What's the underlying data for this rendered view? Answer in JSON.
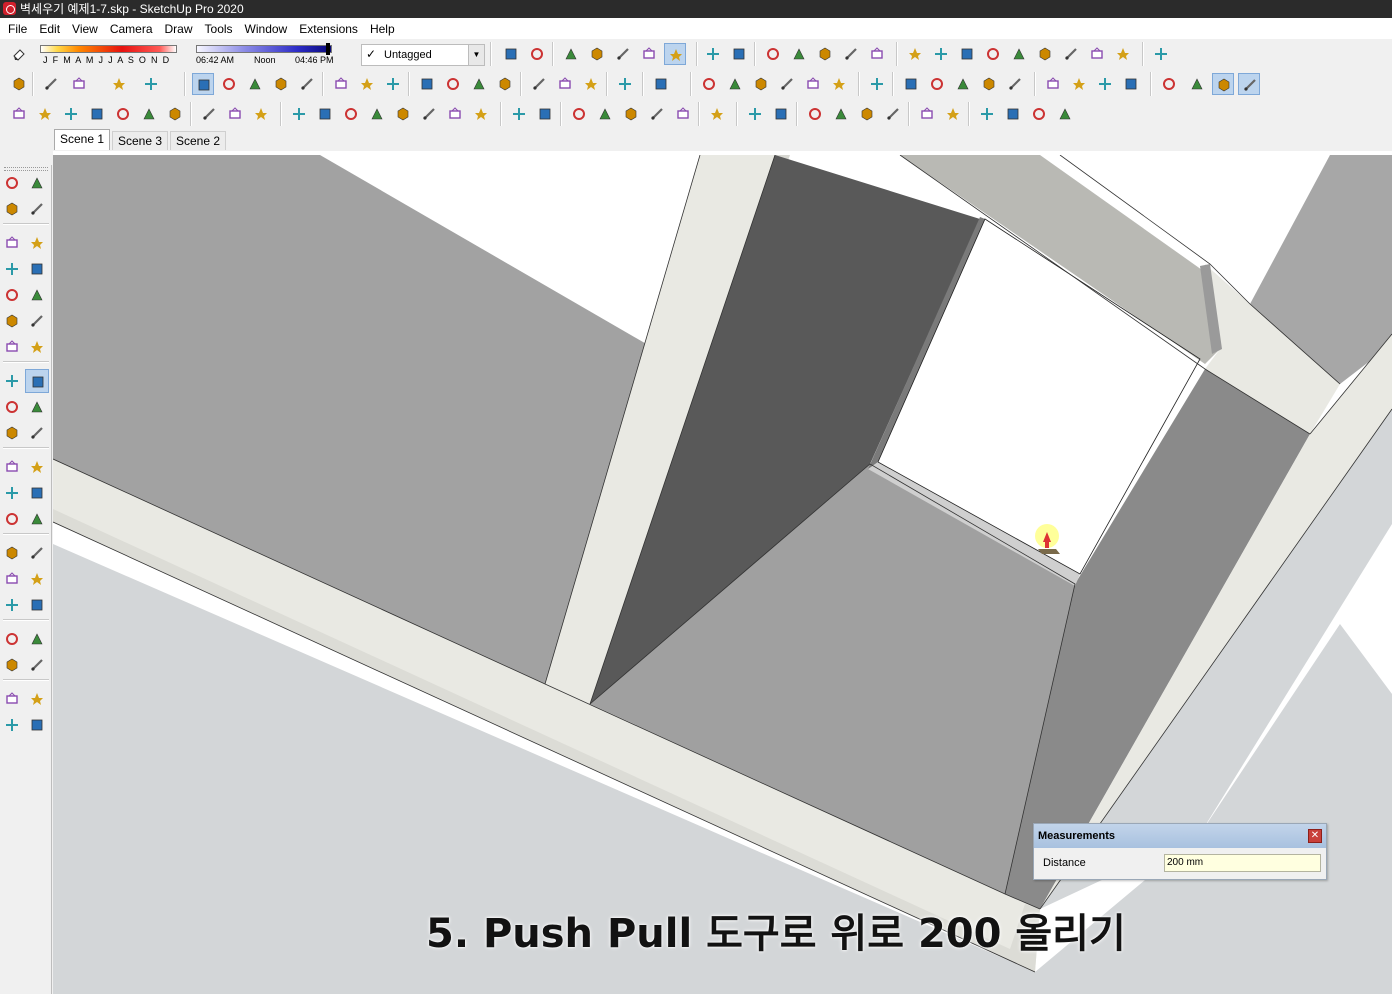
{
  "window": {
    "title": "벽세우기 예제1-7.skp - SketchUp Pro 2020"
  },
  "menu": [
    "File",
    "Edit",
    "View",
    "Camera",
    "Draw",
    "Tools",
    "Window",
    "Extensions",
    "Help"
  ],
  "shadow_settings": {
    "months": "J F M A M J J A S O N D",
    "time_start": "06:42 AM",
    "time_noon": "Noon",
    "time_end": "04:46 PM"
  },
  "tag_selector": {
    "value": "Untagged"
  },
  "scenes": [
    "Scene 1",
    "Scene 3",
    "Scene 2"
  ],
  "active_scene": "Scene 1",
  "active_tool": "push-pull",
  "measurements": {
    "title": "Measurements",
    "label": "Distance",
    "value": "200 mm"
  },
  "caption": "5. Push Pull 도구로 위로 200 올리기",
  "colors": {
    "accent_active": "#bcd4ee",
    "model_gray": "#a0a0a0",
    "model_dark": "#595959",
    "model_light": "#e8e8e0",
    "ground": "#d3d6d8"
  },
  "toolbar_icons": [
    "eraser-icon",
    "tag-icon",
    "section-plane-icon",
    "xray-icon",
    "wireframe-icon",
    "hidden-line-icon",
    "shaded-icon",
    "shaded-textures-icon",
    "monochrome-icon",
    "iso-view-icon",
    "top-view-icon",
    "front-view-icon",
    "right-view-icon",
    "back-view-icon",
    "left-view-icon",
    "orbit-icon",
    "pan-icon",
    "zoom-icon",
    "zoom-window-icon",
    "zoom-extents-icon",
    "previous-view-icon",
    "position-camera-icon",
    "look-around-icon",
    "walk-icon",
    "warehouse-icon"
  ]
}
